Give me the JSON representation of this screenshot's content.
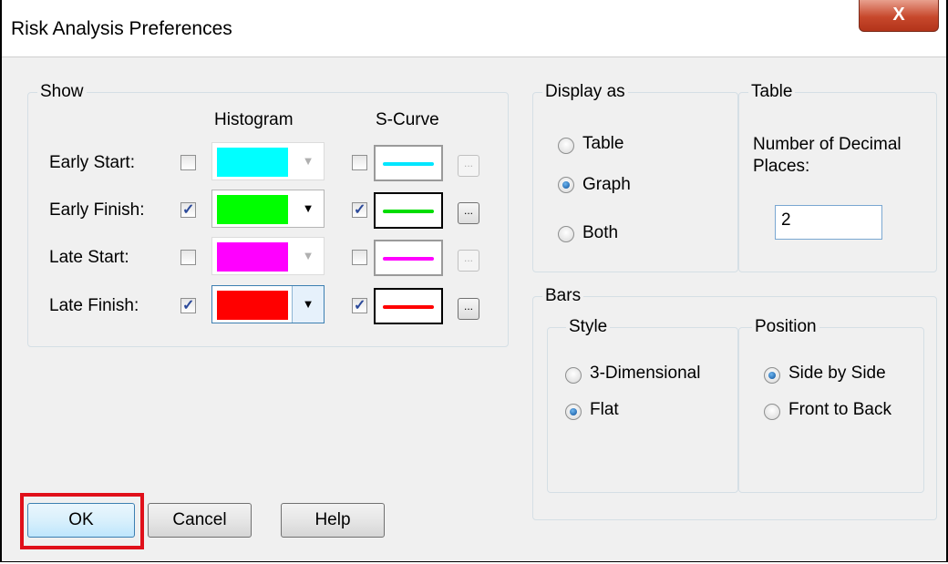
{
  "window": {
    "title": "Risk Analysis Preferences",
    "close_glyph": "X"
  },
  "show": {
    "title": "Show",
    "histogram_header": "Histogram",
    "scurve_header": "S-Curve",
    "rows": [
      {
        "label": "Early Start:",
        "hist_checked": false,
        "color": "#00ffff",
        "enabled": false,
        "curve_checked": false
      },
      {
        "label": "Early Finish:",
        "hist_checked": true,
        "color": "#00ff00",
        "enabled": true,
        "curve_checked": true
      },
      {
        "label": "Late Start:",
        "hist_checked": false,
        "color": "#ff00ff",
        "enabled": false,
        "curve_checked": false
      },
      {
        "label": "Late Finish:",
        "hist_checked": true,
        "color": "#ff0000",
        "enabled": true,
        "curve_checked": true
      }
    ],
    "ellipsis": "..."
  },
  "display_as": {
    "title": "Display as",
    "options": [
      "Table",
      "Graph",
      "Both"
    ],
    "selected": "Graph"
  },
  "table": {
    "title": "Table",
    "label": "Number of Decimal Places:",
    "value": "2"
  },
  "bars": {
    "title": "Bars",
    "style": {
      "title": "Style",
      "options": [
        "3-Dimensional",
        "Flat"
      ],
      "selected": "Flat"
    },
    "position": {
      "title": "Position",
      "options": [
        "Side by Side",
        "Front to Back"
      ],
      "selected": "Side by Side"
    }
  },
  "buttons": {
    "ok": "OK",
    "cancel": "Cancel",
    "help": "Help"
  },
  "colors": {
    "highlight": "#e0101a",
    "accent": "#3c7fb1"
  }
}
